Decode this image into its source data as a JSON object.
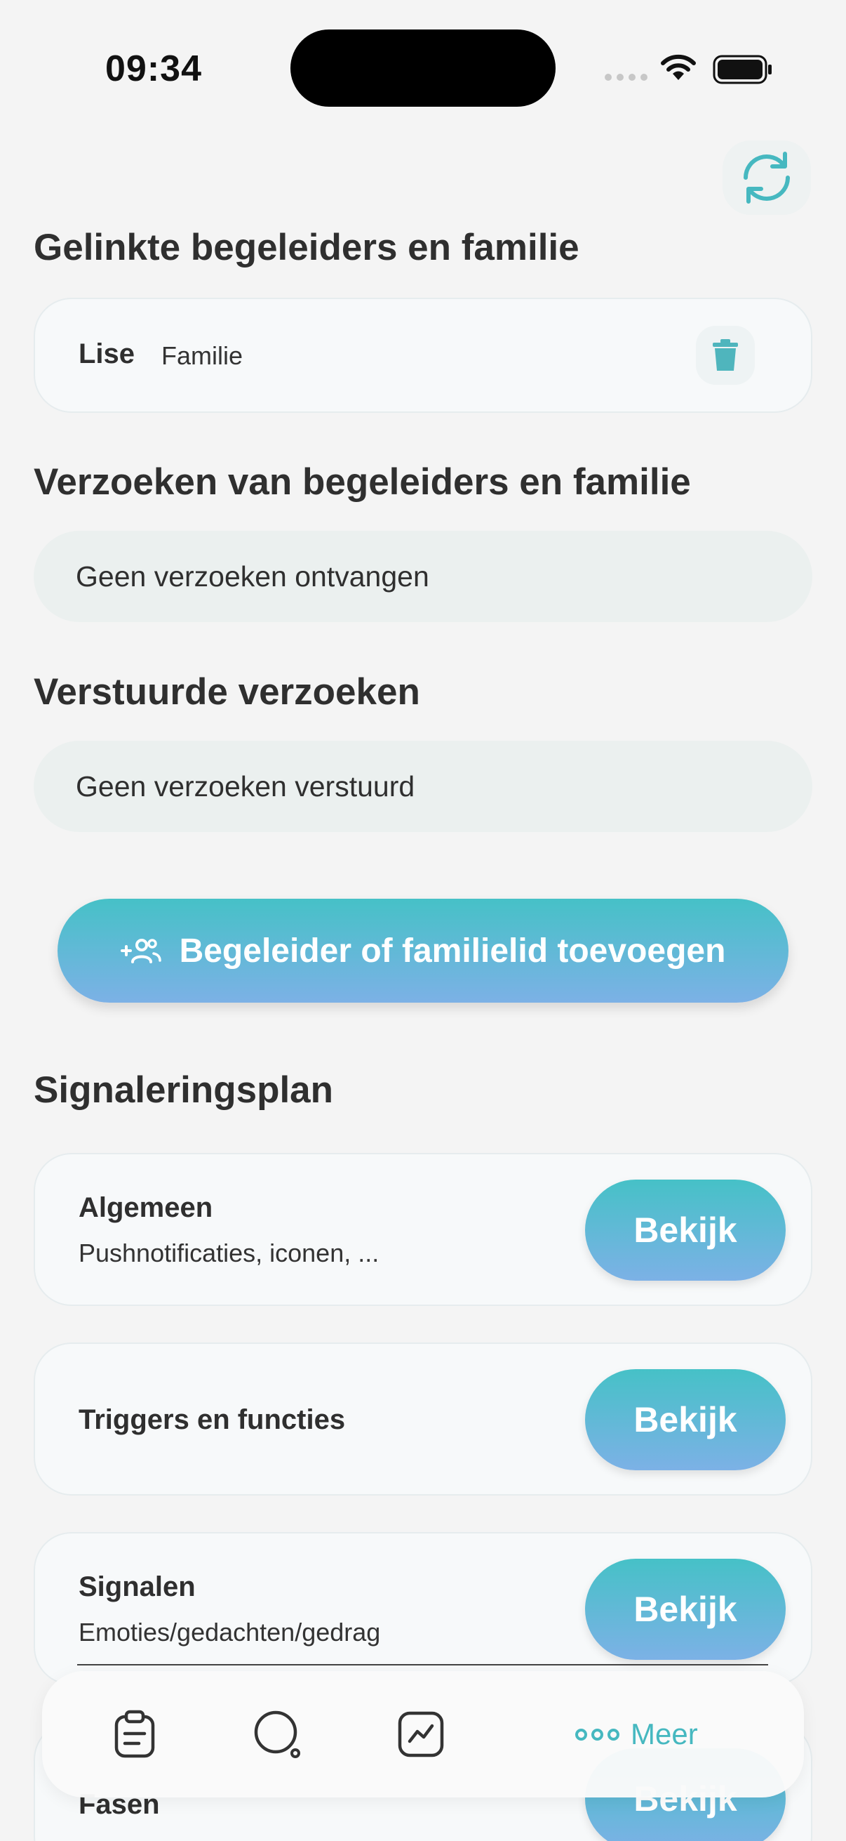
{
  "status_bar": {
    "time": "09:34"
  },
  "linked_section": {
    "title": "Gelinkte begeleiders en familie",
    "items": [
      {
        "name": "Lise",
        "role": "Familie"
      }
    ]
  },
  "requests_section": {
    "title": "Verzoeken van begeleiders en familie",
    "empty_text": "Geen verzoeken ontvangen"
  },
  "sent_section": {
    "title": "Verstuurde verzoeken",
    "empty_text": "Geen verzoeken verstuurd"
  },
  "add_button": {
    "label": "Begeleider of familielid toevoegen"
  },
  "plan_section": {
    "title": "Signaleringsplan",
    "items": [
      {
        "title": "Algemeen",
        "subtitle": "Pushnotificaties, iconen, ...",
        "button": "Bekijk"
      },
      {
        "title": "Triggers en functies",
        "subtitle": "",
        "button": "Bekijk"
      },
      {
        "title": "Signalen",
        "subtitle": "Emoties/gedachten/gedrag",
        "button": "Bekijk"
      },
      {
        "title": "Fasen",
        "subtitle": "",
        "button": "Bekijk"
      }
    ]
  },
  "tab_bar": {
    "tabs": [
      {
        "icon": "clipboard-icon"
      },
      {
        "icon": "search-icon"
      },
      {
        "icon": "chart-icon"
      }
    ],
    "more_label": "Meer"
  },
  "colors": {
    "accent": "#46b8c0",
    "gradient_top": "#46c1c7",
    "gradient_bottom": "#7cb1e6",
    "background": "#f4f4f4"
  }
}
